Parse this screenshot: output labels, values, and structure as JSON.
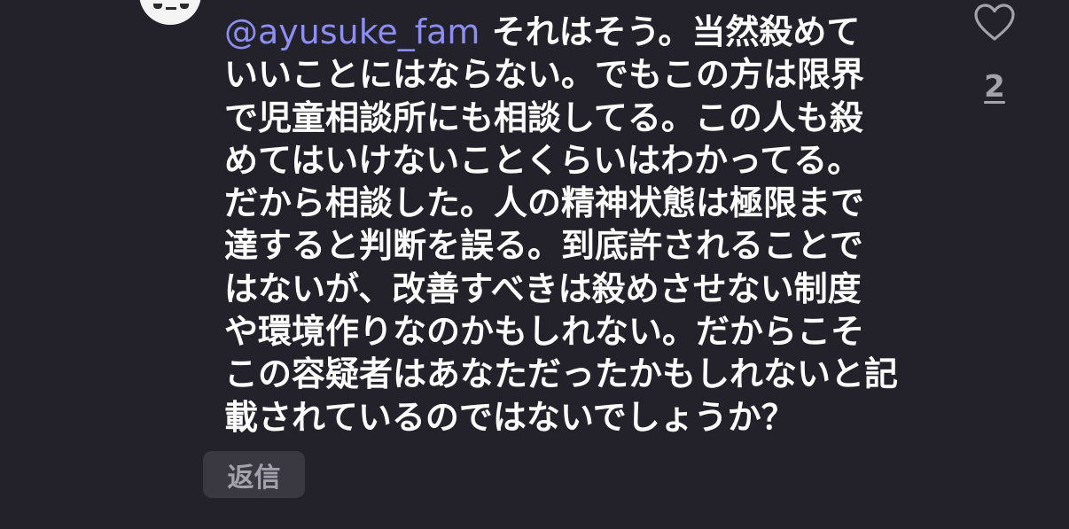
{
  "comment": {
    "mention": "@ayusuke_fam",
    "lines": [
      " それはそう。当然殺めて",
      "いいことにはならない。でもこの方は限界",
      "で児童相談所にも相談してる。この人も殺",
      "めてはいけないことくらいはわかってる。",
      "だから相談した。人の精神状態は極限まで",
      "達すると判断を誤る。到底許されることで",
      "はないが、改善すべきは殺めさせない制度",
      "や環境作りなのかもしれない。だからこそ",
      "この容疑者はあなただったかもしれないと記",
      "載されているのではないでしょうか？"
    ]
  },
  "actions": {
    "reply_label": "返信",
    "like_count": "2",
    "like_icon": "heart-outline-icon"
  },
  "colors": {
    "background": "#232129",
    "text": "#ffffff",
    "mention": "#8c8ef2",
    "muted": "#a3a1aa",
    "button_bg": "#3a3841"
  }
}
